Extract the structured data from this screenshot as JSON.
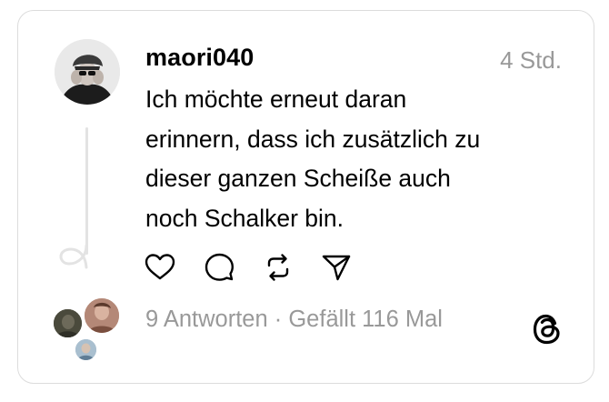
{
  "post": {
    "username": "maori040",
    "timestamp": "4 Std.",
    "text_lines": [
      "Ich möchte erneut daran",
      "erinnern, dass ich zusätzlich zu",
      "dieser ganzen Scheiße auch",
      "noch Schalker bin."
    ]
  },
  "actions": {
    "like_icon": "heart-icon",
    "reply_icon": "comment-icon",
    "repost_icon": "repost-icon",
    "share_icon": "send-icon"
  },
  "stats": {
    "replies": "9 Antworten",
    "separator": " · ",
    "likes": "Gefällt 116 Mal"
  },
  "brand": {
    "logo_icon": "threads-logo-icon",
    "text_color": "#000000",
    "muted_color": "#999999"
  }
}
